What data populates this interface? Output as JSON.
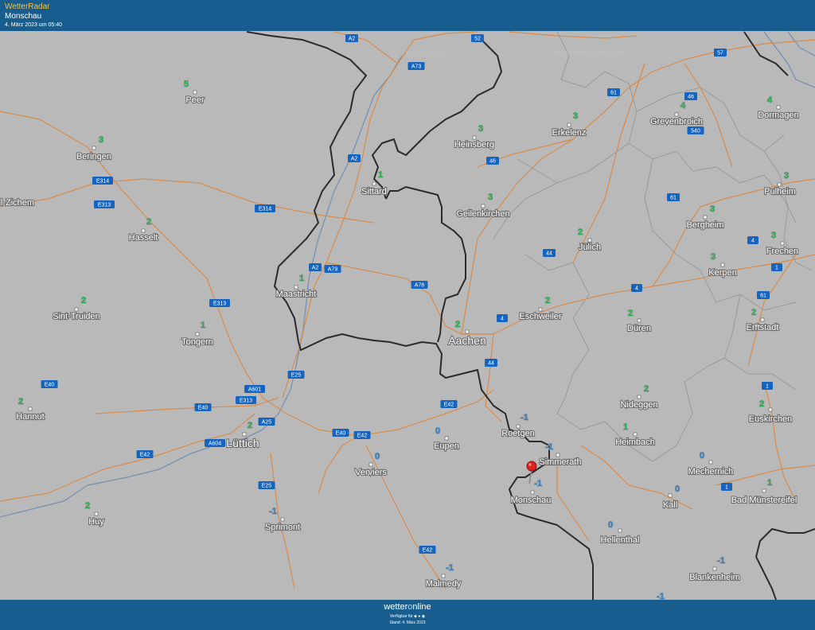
{
  "header": {
    "brand": "WetterRadar",
    "place": "Monschau",
    "timestamp": "4. März 2023 um 05:40"
  },
  "footer": {
    "logo_part1": "wetter",
    "logo_part2": "o",
    "logo_part3": "nline",
    "availability": "Verfügbar für ◆ ● ◉",
    "stand": "Stand: 4. März 2023"
  },
  "colors": {
    "bar": "#175e8e",
    "map_background": "#b9b9b9",
    "positive_temp": "#21b24b",
    "negative_temp": "#2f7fc4",
    "road": "#d98c4a",
    "river": "#7591b3",
    "border": "#2b2b2b"
  },
  "marker": {
    "icon": "map-pin-icon",
    "color": "#e0201b",
    "place": "Monschau"
  },
  "cities": [
    {
      "name": "Peer",
      "temp": "5"
    },
    {
      "name": "Beringen",
      "temp": "3"
    },
    {
      "name": "l-Zichem",
      "temp": ""
    },
    {
      "name": "Hasselt",
      "temp": "2"
    },
    {
      "name": "Sint-Truiden",
      "temp": "2"
    },
    {
      "name": "Tongern",
      "temp": "1"
    },
    {
      "name": "Hannut",
      "temp": "2"
    },
    {
      "name": "Huy",
      "temp": "2"
    },
    {
      "name": "Lüttich",
      "temp": "2"
    },
    {
      "name": "Sprimont",
      "temp": "-1"
    },
    {
      "name": "Verviers",
      "temp": "0"
    },
    {
      "name": "Eupen",
      "temp": "0"
    },
    {
      "name": "Malmedy",
      "temp": "-1"
    },
    {
      "name": "Maastricht",
      "temp": "1"
    },
    {
      "name": "Sittard",
      "temp": "1"
    },
    {
      "name": "Heinsberg",
      "temp": "3"
    },
    {
      "name": "Geilenkirchen",
      "temp": "3"
    },
    {
      "name": "Aachen",
      "temp": "2"
    },
    {
      "name": "Eschweiler",
      "temp": "2"
    },
    {
      "name": "Roetgen",
      "temp": "-1"
    },
    {
      "name": "Simmerath",
      "temp": "-1"
    },
    {
      "name": "Monschau",
      "temp": "-1"
    },
    {
      "name": "Hellenthal",
      "temp": "0"
    },
    {
      "name": "Heimbach",
      "temp": "1"
    },
    {
      "name": "Nideggen",
      "temp": "2"
    },
    {
      "name": "Düren",
      "temp": "2"
    },
    {
      "name": "Jülich",
      "temp": "2"
    },
    {
      "name": "Erkelenz",
      "temp": "3"
    },
    {
      "name": "Grevenbroich",
      "temp": "4"
    },
    {
      "name": "Dormagen",
      "temp": "4"
    },
    {
      "name": "Pulheim",
      "temp": "3"
    },
    {
      "name": "Bergheim",
      "temp": "3"
    },
    {
      "name": "Frechen",
      "temp": "3"
    },
    {
      "name": "Kerpen",
      "temp": "3"
    },
    {
      "name": "Erftstadt",
      "temp": "2"
    },
    {
      "name": "Euskirchen",
      "temp": "2"
    },
    {
      "name": "Mechernich",
      "temp": "0"
    },
    {
      "name": "Kall",
      "temp": "0"
    },
    {
      "name": "Bad Münstereifel",
      "temp": "1"
    },
    {
      "name": "Blankenheim",
      "temp": "-1"
    },
    {
      "name": "Mönchengladbach",
      "temp": ""
    },
    {
      "name": "Roermond",
      "temp": ""
    }
  ],
  "edge_temps": [
    "-1"
  ],
  "road_labels": [
    "A2",
    "A73",
    "52",
    "57",
    "61",
    "46",
    "540",
    "A2",
    "E314",
    "E313",
    "E314",
    "46",
    "61",
    "44",
    "A2",
    "A79",
    "A76",
    "4",
    "4",
    "1",
    "61",
    "4",
    "E313",
    "E25",
    "A601",
    "E313",
    "E40",
    "A25",
    "A604",
    "E42",
    "E40",
    "E42",
    "E40",
    "44",
    "E42",
    "E42",
    "E25",
    "1",
    "1"
  ]
}
